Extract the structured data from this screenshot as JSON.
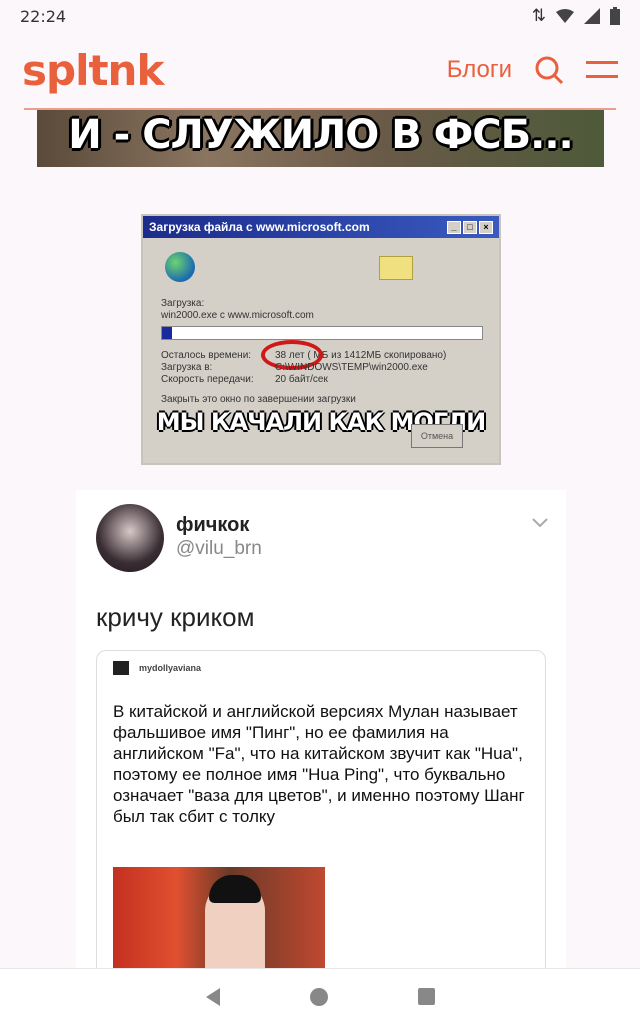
{
  "status_bar": {
    "time": "22:24"
  },
  "header": {
    "logo": "spltnk",
    "blogs_link": "Блоги"
  },
  "colors": {
    "accent": "#e8603c",
    "background": "#fbf7fb"
  },
  "meme1": {
    "caption": "И - СЛУЖИЛО В ФСБ..."
  },
  "meme2": {
    "window_title": "Загрузка файла с www.microsoft.com",
    "loading_label": "Загрузка:",
    "file_line": "win2000.exe с www.microsoft.com",
    "remaining_label": "Осталось времени:",
    "remaining_value": "38 лет ( МБ из 1412МБ скопировано)",
    "target_label": "Загрузка в:",
    "target_value": "C:\\WINDOWS\\TEMP\\win2000.exe",
    "speed_label": "Скорость передачи:",
    "speed_value": "20 байт/сек",
    "close_checkbox": "Закрыть это окно по завершении загрузки",
    "cancel_button": "Отмена",
    "caption": "МЫ КАЧАЛИ КАК МОГЛИ",
    "progress_fraction": 0.03
  },
  "tweet": {
    "name": "фичкок",
    "handle": "@vilu_brn",
    "text": "кричу криком",
    "quote": {
      "user": "mydollyaviana",
      "text": "В китайской и английской версиях Мулан называет фальшивое имя \"Пинг\", но ее фамилия на английском \"Fa\", что на китайском звучит как \"Hua\", поэтому ее полное имя \"Hua Ping\", что буквально означает \"ваза для цветов\", и именно поэтому Шанг был так сбит с толку"
    }
  }
}
